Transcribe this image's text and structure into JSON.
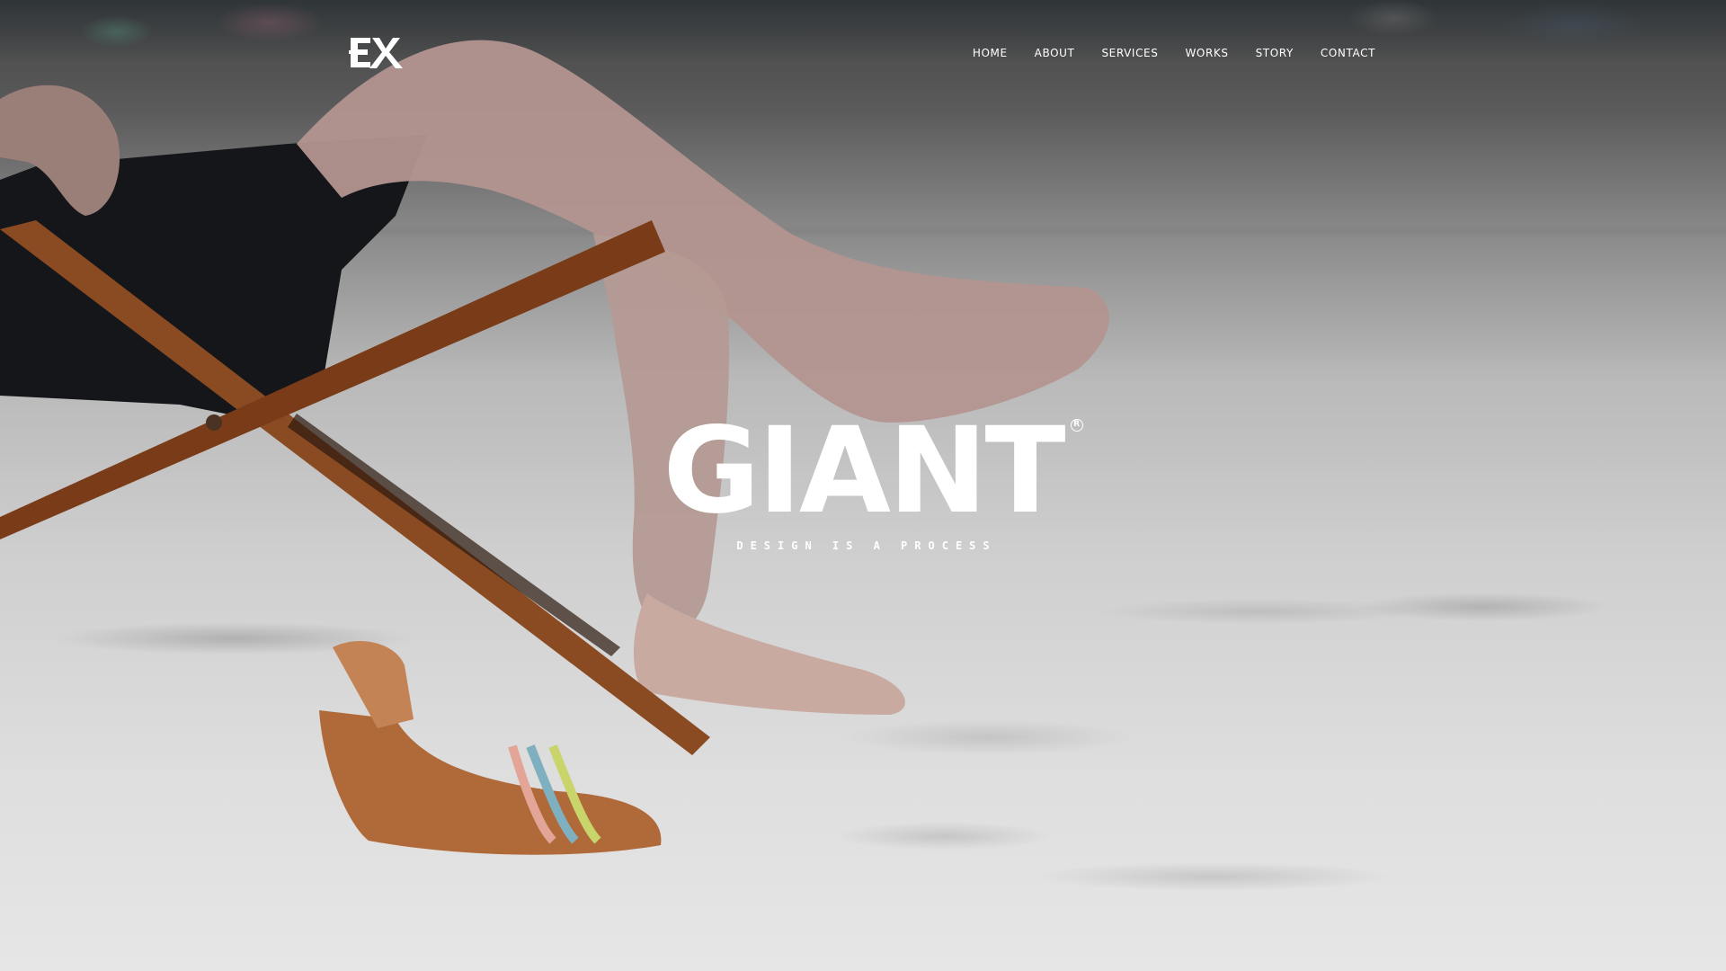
{
  "brand": {
    "logo_text": "EX",
    "title": "GIANT",
    "registered_mark": "R",
    "tagline": "DESIGN IS A PROCESS"
  },
  "nav": {
    "items": [
      {
        "label": "HOME"
      },
      {
        "label": "ABOUT"
      },
      {
        "label": "SERVICES"
      },
      {
        "label": "WORKS"
      },
      {
        "label": "STORY"
      },
      {
        "label": "CONTACT"
      }
    ]
  },
  "colors": {
    "text": "#ffffff",
    "overlay_top": "#454545",
    "sand": "#dedede",
    "wood": "#8a4a22",
    "skin": "#c9a594",
    "shoe": "#b06a3a"
  },
  "hero": {
    "image_description_icon": "beach-chair-photo"
  }
}
